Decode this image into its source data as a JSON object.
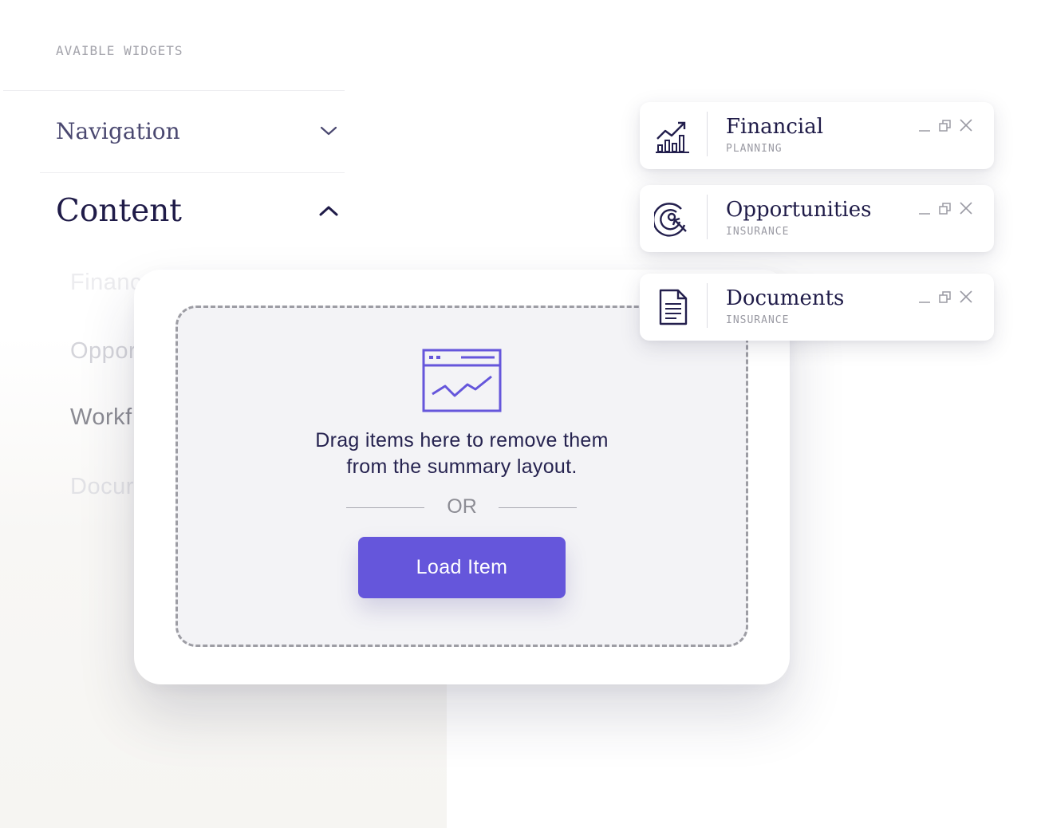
{
  "sidebar": {
    "section_label": "AVAIBLE WIDGETS",
    "accordion": [
      {
        "title": "Navigation",
        "state": "collapsed",
        "icon": "chevron-down-icon"
      },
      {
        "title": "Content",
        "state": "expanded",
        "icon": "chevron-up-icon"
      }
    ],
    "content_items": [
      "Financ",
      "Oppor",
      "Workf",
      "Docur"
    ]
  },
  "drop_zone": {
    "icon": "browser-chart-icon",
    "message_line_1": "Drag items here to remove them",
    "message_line_2": "from the summary layout.",
    "separator": "OR",
    "button_label": "Load Item"
  },
  "widgets": [
    {
      "title": "Financial",
      "subtitle": "PLANNING",
      "icon": "growth-chart-icon"
    },
    {
      "title": "Opportunities",
      "subtitle": "INSURANCE",
      "icon": "target-cursor-icon"
    },
    {
      "title": "Documents",
      "subtitle": "INSURANCE",
      "icon": "document-icon"
    }
  ],
  "widget_controls": [
    "minimize-icon",
    "restore-icon",
    "close-icon"
  ],
  "colors": {
    "accent": "#6556db",
    "heading": "#1f1b48",
    "muted": "#a3a3ab",
    "drop_zone_bg": "#f3f3f6"
  }
}
